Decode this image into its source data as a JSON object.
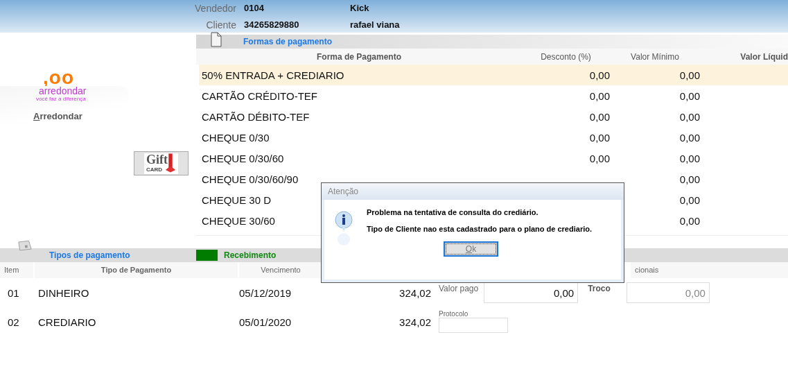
{
  "header": {
    "fields": [
      {
        "label": "Vendedor",
        "code": "0104",
        "name": "Kick"
      },
      {
        "label": "Cliente",
        "code": "34265829880",
        "name": "rafael viana"
      }
    ]
  },
  "rounding": {
    "amount": ",oo",
    "brand": "arredondar",
    "tagline": "você faz a diferença",
    "button": "Arredondar"
  },
  "gift_card": {
    "label": "Gift",
    "sublabel": "CARD"
  },
  "payment_forms": {
    "title": "Formas de pagamento",
    "columns": [
      "Forma de Pagamento",
      "Desconto (%)",
      "Valor Mínimo",
      "Valor Líquid"
    ],
    "rows": [
      {
        "name": "50% ENTRADA + CREDIARIO",
        "discount": "0,00",
        "minimum": "0,00",
        "selected": true
      },
      {
        "name": "CARTÃO CRÉDITO-TEF",
        "discount": "0,00",
        "minimum": "0,00",
        "selected": false
      },
      {
        "name": "CARTÃO DÉBITO-TEF",
        "discount": "0,00",
        "minimum": "0,00",
        "selected": false
      },
      {
        "name": "CHEQUE 0/30",
        "discount": "0,00",
        "minimum": "0,00",
        "selected": false
      },
      {
        "name": "CHEQUE 0/30/60",
        "discount": "0,00",
        "minimum": "0,00",
        "selected": false
      },
      {
        "name": "CHEQUE 0/30/60/90",
        "minimum": "0,00",
        "selected": false
      },
      {
        "name": "CHEQUE 30 D",
        "minimum": "0,00",
        "selected": false
      },
      {
        "name": "CHEQUE 30/60",
        "minimum": "0,00",
        "selected": false
      }
    ]
  },
  "payment_types": {
    "title": "Tipos de pagamento",
    "receipt": "Recebimento",
    "columns": [
      "Item",
      "Tipo de Pagamento",
      "Vencimento",
      "cionais"
    ],
    "rows": [
      {
        "item": "01",
        "type": "DINHEIRO",
        "due": "05/12/2019",
        "amount": "324,02"
      },
      {
        "item": "02",
        "type": "CREDIARIO",
        "due": "05/01/2020",
        "amount": "324,02"
      }
    ]
  },
  "payment_entry": {
    "paid_label": "Valor pago",
    "paid_value": "0,00",
    "change_label": "Troco",
    "change_value": "0,00",
    "change_disabled": true,
    "protocol_label": "Protocolo"
  },
  "dialog": {
    "title": "Atenção",
    "messages": [
      "Problema na tentativa de consulta do crediário.",
      "Tipo de Cliente nao esta cadastrado para o plano de crediario."
    ],
    "button": "Ok"
  }
}
